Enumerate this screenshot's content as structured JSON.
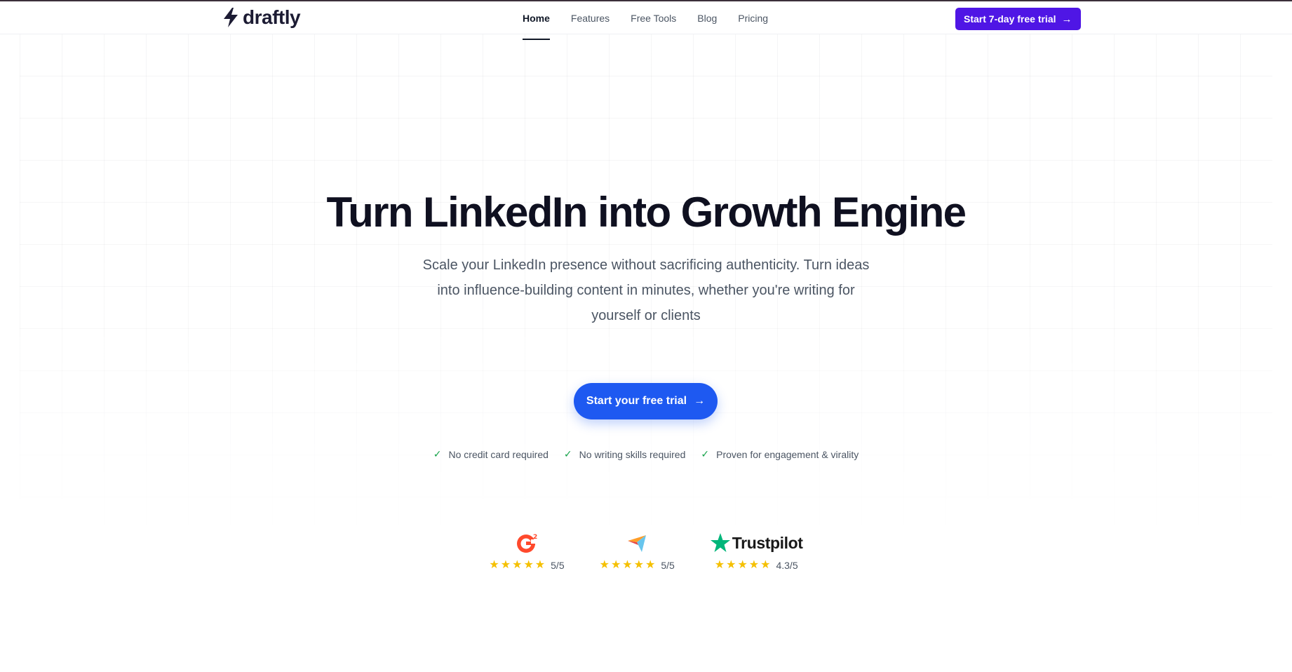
{
  "header": {
    "brand": "draftly",
    "nav": [
      {
        "label": "Home",
        "active": true
      },
      {
        "label": "Features",
        "active": false
      },
      {
        "label": "Free Tools",
        "active": false
      },
      {
        "label": "Blog",
        "active": false
      },
      {
        "label": "Pricing",
        "active": false
      }
    ],
    "cta_label": "Start 7-day free trial"
  },
  "hero": {
    "title": "Turn LinkedIn into Growth Engine",
    "subtitle_line1": "Scale your LinkedIn presence without sacrificing authenticity. Turn ideas",
    "subtitle_line2": "into influence-building content in minutes, whether you're writing for",
    "subtitle_line3": "yourself or clients",
    "cta_label": "Start your free trial"
  },
  "checks": [
    "No credit card required",
    "No writing skills required",
    "Proven for engagement & virality"
  ],
  "ratings": [
    {
      "brand": "G2",
      "score": "5/5",
      "stars": 5
    },
    {
      "brand": "Capterra",
      "score": "5/5",
      "stars": 5
    },
    {
      "brand": "Trustpilot",
      "score": "4.3/5",
      "stars": 5
    }
  ],
  "colors": {
    "primary_purple": "#4f16e5",
    "primary_blue": "#1e59f1",
    "check_green": "#16a34a",
    "star_yellow": "#f5c000",
    "g2_red": "#ff492c",
    "trustpilot_green": "#00b67a"
  },
  "icons": {
    "logo": "lightning-bolt-icon",
    "arrow": "arrow-right-icon",
    "check": "check-icon",
    "star": "star-icon"
  }
}
